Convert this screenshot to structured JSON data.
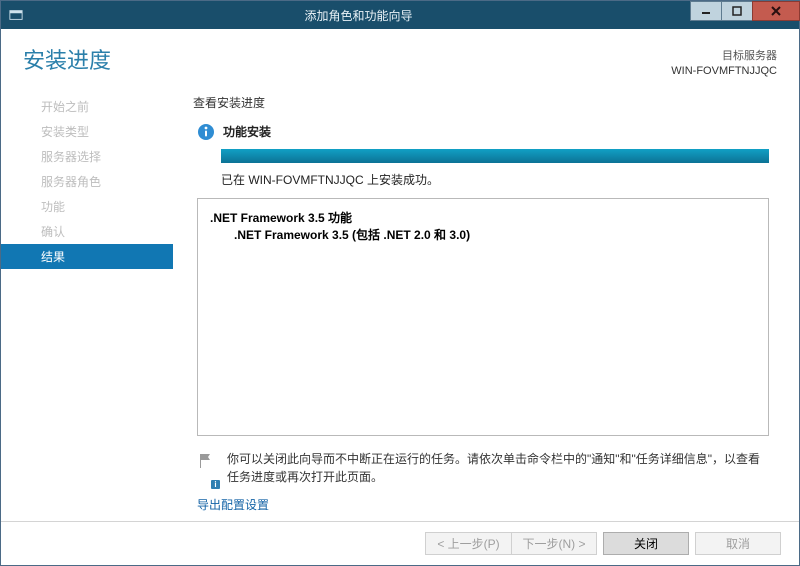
{
  "window": {
    "title": "添加角色和功能向导"
  },
  "header": {
    "page_title": "安装进度",
    "target_label": "目标服务器",
    "target_server": "WIN-FOVMFTNJJQC"
  },
  "nav": {
    "items": [
      {
        "label": "开始之前"
      },
      {
        "label": "安装类型"
      },
      {
        "label": "服务器选择"
      },
      {
        "label": "服务器角色"
      },
      {
        "label": "功能"
      },
      {
        "label": "确认"
      },
      {
        "label": "结果"
      }
    ],
    "active_index": 6
  },
  "panel": {
    "section_title": "查看安装进度",
    "status_text": "功能安装",
    "done_text": "已在 WIN-FOVMFTNJJQC 上安装成功。",
    "features": {
      "line1": ".NET Framework 3.5 功能",
      "line2": ".NET Framework 3.5 (包括 .NET 2.0 和 3.0)"
    },
    "note": "你可以关闭此向导而不中断正在运行的任务。请依次单击命令栏中的\"通知\"和\"任务详细信息\"，以查看任务进度或再次打开此页面。",
    "flag_badge": "i",
    "export_link": "导出配置设置"
  },
  "buttons": {
    "prev": "< 上一步(P)",
    "next": "下一步(N) >",
    "close": "关闭",
    "cancel": "取消"
  }
}
